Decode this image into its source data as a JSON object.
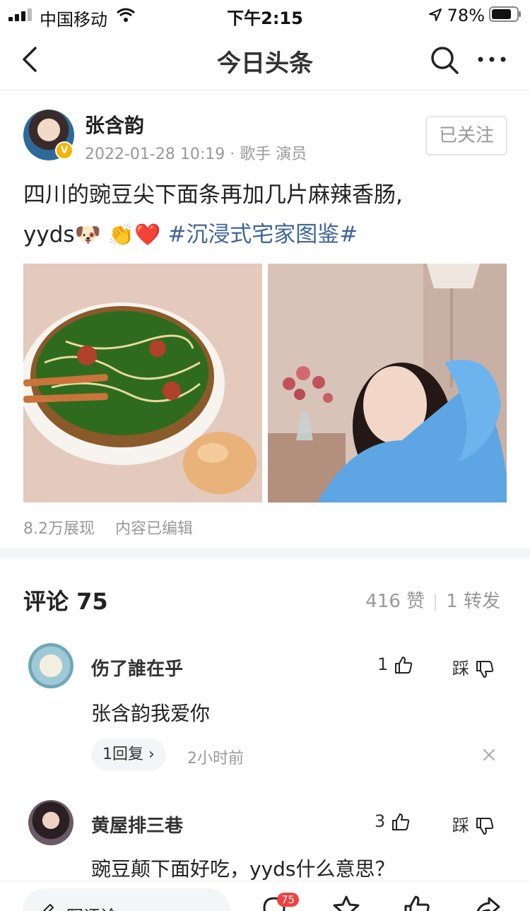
{
  "status_bar": {
    "carrier": "中国移动",
    "time": "下午2:15",
    "battery": "78%"
  },
  "nav": {
    "title": "今日头条"
  },
  "post": {
    "author_name": "张含韵",
    "meta": "2022-01-28 10:19 · 歌手 演员",
    "follow_label": "已关注",
    "verified_mark": "V",
    "text_line1": "四川的豌豆尖下面条再加几片麻辣香肠,",
    "text_line2_prefix": "yyds",
    "emojis": [
      "🐶",
      "👏",
      "❤️"
    ],
    "hashtag": "#沉浸式宅家图鉴#",
    "stats": {
      "views": "8.2万展现",
      "edited": "内容已编辑"
    }
  },
  "comments_header": {
    "title": "评论 75",
    "likes": "416 赞",
    "shares": "1 转发"
  },
  "comments": [
    {
      "name": "伤了誰在乎",
      "likes": "1",
      "dislike_label": "踩",
      "text": "张含韵我爱你",
      "replies": "1回复 ›",
      "time": "2小时前"
    },
    {
      "name": "黄屋排三巷",
      "likes": "3",
      "dislike_label": "踩",
      "text": "豌豆颠下面好吃，yyds什么意思？"
    }
  ],
  "bottom_bar": {
    "write_comment": "写评论",
    "comment_badge": "75"
  },
  "colors": {
    "hashtag": "#406599",
    "badge": "#f04142",
    "verified": "#f5b400"
  }
}
